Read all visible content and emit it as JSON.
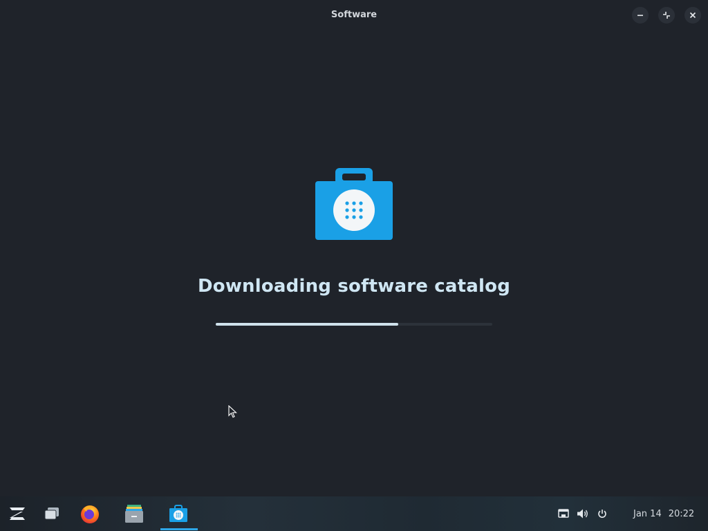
{
  "window": {
    "title": "Software",
    "buttons": {
      "minimize_icon": "minimize-icon",
      "maximize_icon": "restore-icon",
      "close_icon": "close-icon"
    }
  },
  "main": {
    "app_icon": "software-store-icon",
    "heading": "Downloading software catalog",
    "progress": 0.66,
    "accent_color": "#1aa0e6"
  },
  "taskbar": {
    "items": [
      {
        "name": "zorin-menu",
        "icon": "zorin-logo-icon"
      },
      {
        "name": "window-switcher",
        "icon": "windows-overview-icon"
      },
      {
        "name": "firefox",
        "icon": "firefox-icon"
      },
      {
        "name": "files",
        "icon": "file-cabinet-icon"
      },
      {
        "name": "software",
        "icon": "software-store-icon",
        "active": true
      }
    ],
    "tray": {
      "network_icon": "network-icon",
      "volume_icon": "volume-icon",
      "power_icon": "power-icon"
    },
    "clock": {
      "date": "Jan 14",
      "time": "20:22"
    }
  }
}
